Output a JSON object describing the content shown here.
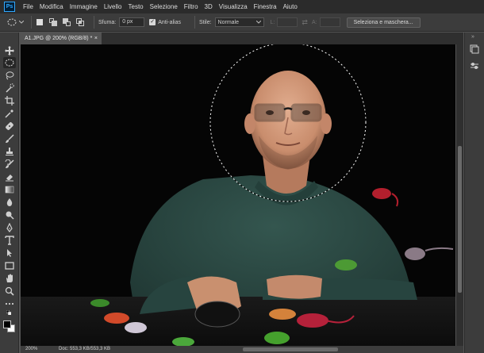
{
  "menu": {
    "logo": "Ps",
    "items": [
      "File",
      "Modifica",
      "Immagine",
      "Livello",
      "Testo",
      "Selezione",
      "Filtro",
      "3D",
      "Visualizza",
      "Finestra",
      "Aiuto"
    ]
  },
  "options": {
    "feather_label": "Sfuma:",
    "feather_value": "0 px",
    "antialias_label": "Anti-alias",
    "style_label": "Stile:",
    "style_value": "Normale",
    "width_label": "L:",
    "height_label": "A:",
    "mask_button": "Seleziona e maschera..."
  },
  "tab": {
    "title": "A1.JPG @ 200% (RGB/8) *",
    "close": "×"
  },
  "status": {
    "zoom": "200%",
    "doc": "Doc: 553,3 KB/553,3 KB"
  },
  "colors": {
    "chrome_dark": "#2b2b2b",
    "chrome": "#3c3c3c",
    "canvas_bg": "#535353",
    "sweater": "#2c4a44",
    "photo_bg": "#050505"
  },
  "toolbar": {
    "tools": [
      "move-tool",
      "elliptical-marquee-tool",
      "lasso-tool",
      "quick-selection-tool",
      "crop-tool",
      "eyedropper-tool",
      "healing-brush-tool",
      "brush-tool",
      "clone-stamp-tool",
      "history-brush-tool",
      "eraser-tool",
      "gradient-tool",
      "blur-tool",
      "dodge-tool",
      "pen-tool",
      "type-tool",
      "path-selection-tool",
      "rectangle-tool",
      "hand-tool",
      "zoom-tool",
      "more-tools"
    ]
  }
}
